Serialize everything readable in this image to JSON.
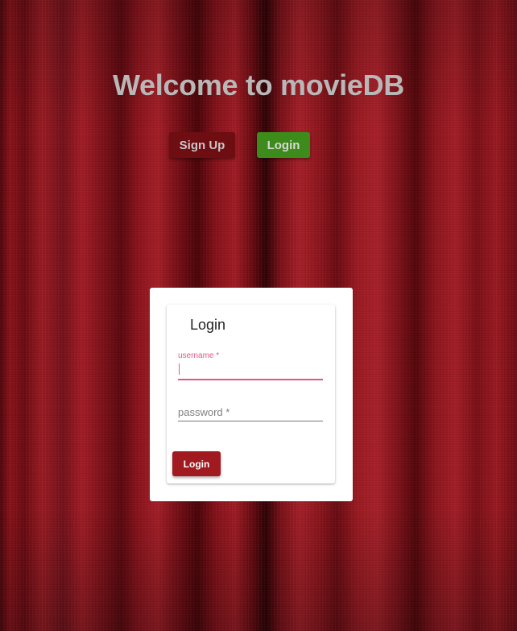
{
  "hero": {
    "title": "Welcome to movieDB",
    "signup_label": "Sign Up",
    "login_label": "Login"
  },
  "login_form": {
    "title": "Login",
    "username": {
      "label": "username *",
      "value": ""
    },
    "password": {
      "placeholder": "password *",
      "value": ""
    },
    "submit_label": "Login"
  },
  "colors": {
    "background": "#7a0d14",
    "signup_button": "#6e0d12",
    "login_button": "#3d8b1a",
    "submit_button": "#a01a20",
    "focus_accent": "#e2577f"
  }
}
